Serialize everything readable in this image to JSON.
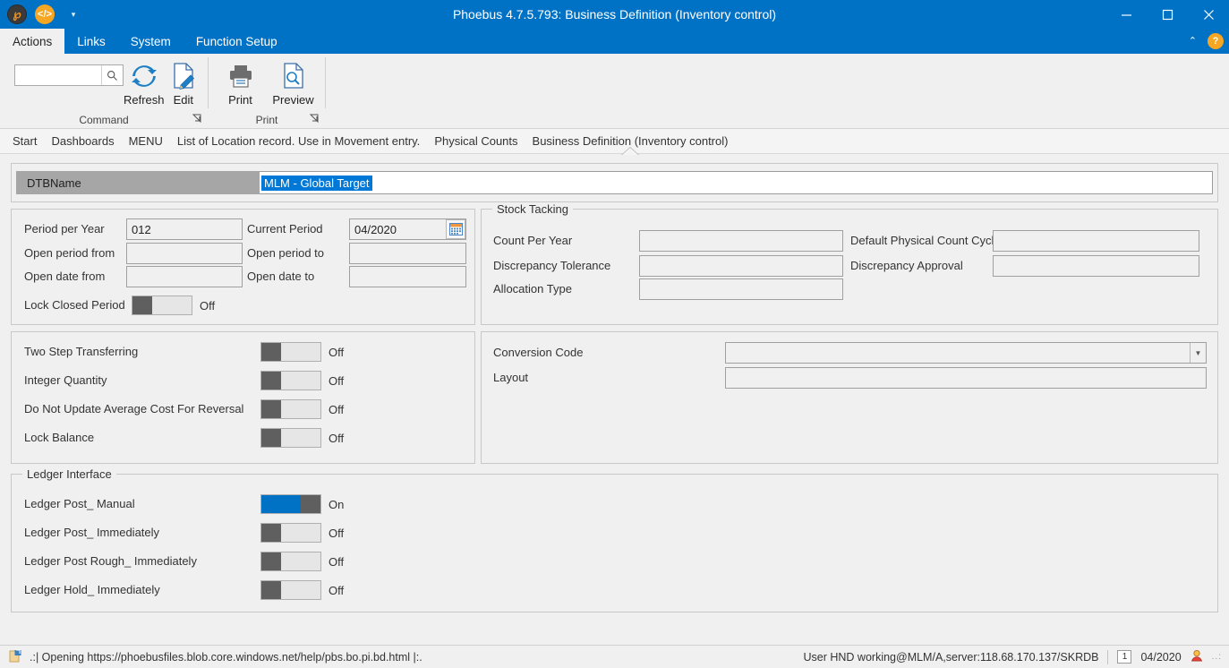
{
  "window": {
    "title": "Phoebus 4.7.5.793: Business Definition (Inventory control)",
    "quick_access": [
      {
        "name": "phoebus-logo-icon",
        "glyph": "℘"
      },
      {
        "name": "code-icon",
        "glyph": "</>"
      },
      {
        "name": "qat-dropdown-icon",
        "glyph": "▾"
      }
    ],
    "controls": {
      "minimize": "—",
      "maximize": "□",
      "close": "✕"
    }
  },
  "menubar": {
    "tabs": [
      {
        "label": "Actions",
        "active": true
      },
      {
        "label": "Links",
        "active": false
      },
      {
        "label": "System",
        "active": false
      },
      {
        "label": "Function Setup",
        "active": false
      }
    ],
    "collapse_icon": "⌃",
    "help_label": "?"
  },
  "ribbon": {
    "search": {
      "value": "",
      "placeholder": ""
    },
    "groups": [
      {
        "title": "Command",
        "launcher": "↘",
        "buttons": [
          {
            "label": "Refresh",
            "icon": "refresh-icon"
          },
          {
            "label": "Edit",
            "icon": "edit-icon"
          }
        ]
      },
      {
        "title": "Print",
        "launcher": "↘",
        "buttons": [
          {
            "label": "Print",
            "icon": "print-icon"
          },
          {
            "label": "Preview",
            "icon": "preview-icon"
          }
        ]
      }
    ]
  },
  "breadcrumbs": [
    {
      "label": "Start",
      "active": false
    },
    {
      "label": "Dashboards",
      "active": false
    },
    {
      "label": "MENU",
      "active": false
    },
    {
      "label": "List of Location record. Use in Movement entry.",
      "active": false
    },
    {
      "label": "Physical Counts",
      "active": false
    },
    {
      "label": "Business Definition (Inventory control)",
      "active": true
    }
  ],
  "form": {
    "dtbname": {
      "label": "DTBName",
      "value": "MLM - Global Target",
      "selected": true
    },
    "period": {
      "fields": [
        {
          "label": "Period per Year",
          "value": "012"
        },
        {
          "label": "Current Period",
          "value": "04/2020",
          "has_calendar": true,
          "calendar_icon": "calendar-icon"
        },
        {
          "label": "Open period from",
          "value": ""
        },
        {
          "label": "Open period to",
          "value": ""
        },
        {
          "label": "Open date from",
          "value": ""
        },
        {
          "label": "Open date to",
          "value": ""
        }
      ],
      "lock_closed_period": {
        "label": "Lock Closed Period",
        "state": "Off",
        "on": false
      }
    },
    "stock_tacking": {
      "legend": "Stock Tacking",
      "fields": [
        {
          "label": "Count Per Year",
          "value": ""
        },
        {
          "label": "Default Physical Count Cycle",
          "value": ""
        },
        {
          "label": "Discrepancy Tolerance",
          "value": ""
        },
        {
          "label": "Discrepancy Approval",
          "value": ""
        },
        {
          "label": "Allocation Type",
          "value": ""
        }
      ]
    },
    "options": [
      {
        "label": "Two Step Transferring",
        "state": "Off",
        "on": false
      },
      {
        "label": "Integer Quantity",
        "state": "Off",
        "on": false
      },
      {
        "label": "Do Not Update Average Cost For Reversal",
        "state": "Off",
        "on": false
      },
      {
        "label": "Lock Balance",
        "state": "Off",
        "on": false
      }
    ],
    "conversion": {
      "fields": [
        {
          "label": "Conversion Code",
          "value": "",
          "is_combo": true
        },
        {
          "label": "Layout",
          "value": "",
          "is_combo": false
        }
      ]
    },
    "ledger_interface": {
      "legend": "Ledger Interface",
      "toggles": [
        {
          "label": "Ledger Post_ Manual",
          "state": "On",
          "on": true
        },
        {
          "label": "Ledger Post_ Immediately",
          "state": "Off",
          "on": false
        },
        {
          "label": "Ledger Post Rough_ Immediately",
          "state": "Off",
          "on": false
        },
        {
          "label": "Ledger Hold_ Immediately",
          "state": "Off",
          "on": false
        }
      ]
    }
  },
  "statusbar": {
    "message": ".:| Opening https://phoebusfiles.blob.core.windows.net/help/pbs.bo.pi.bd.html |:.",
    "user_info": "User HND working@MLM/A,server:118.68.170.137/SKRDB",
    "page_number": "1",
    "period": "04/2020",
    "grip": "..:"
  },
  "colors": {
    "accent": "#0072c6",
    "selection": "#0078d7",
    "toggle_on": "#0072c6",
    "toggle_knob": "#5f5f5f",
    "help": "#f5a623",
    "panel": "#f0f0f0",
    "label_band": "#a6a6a6"
  }
}
